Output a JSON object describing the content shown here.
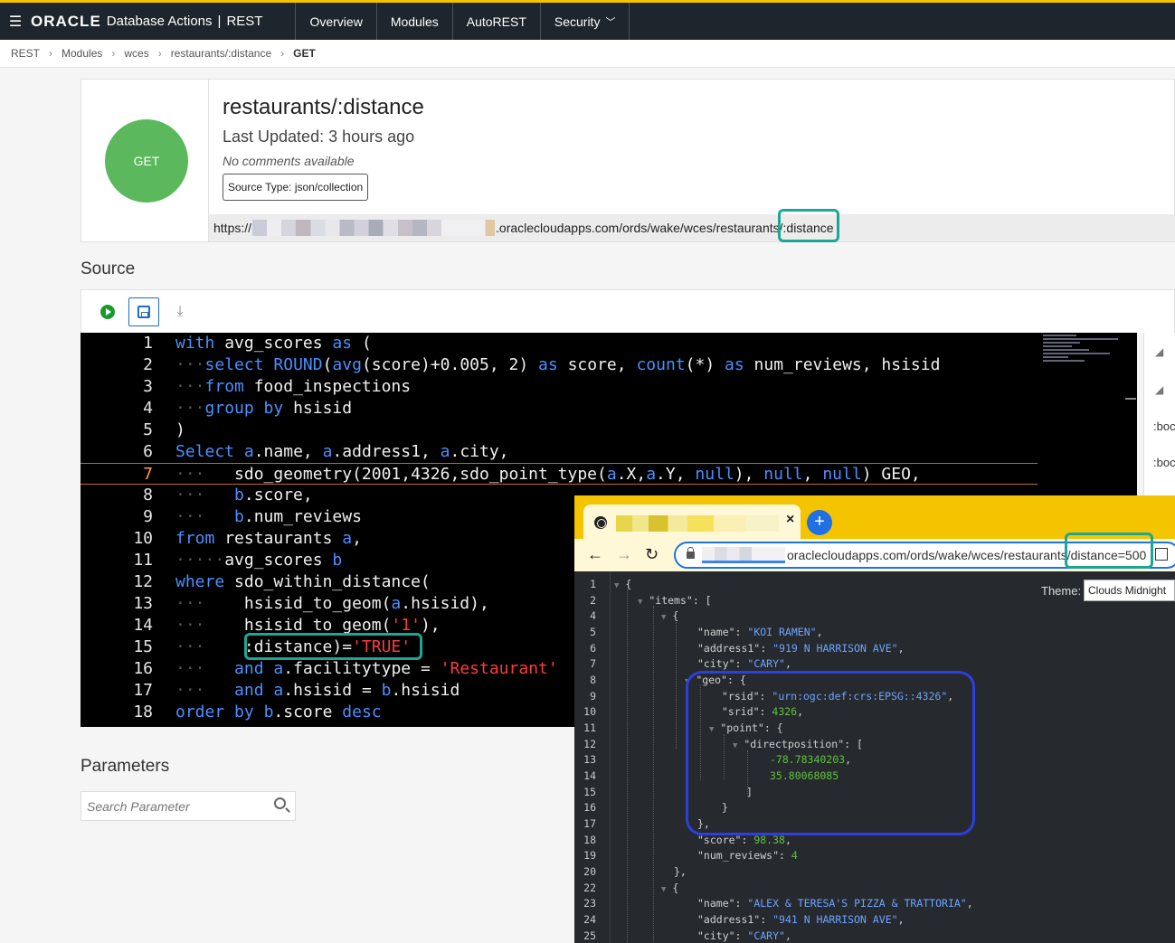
{
  "app": {
    "logo": "ORACLE",
    "product": "Database Actions",
    "separator": "|",
    "section": "REST"
  },
  "nav": {
    "items": [
      "Overview",
      "Modules",
      "AutoREST",
      "Security"
    ]
  },
  "breadcrumb": [
    "REST",
    "Modules",
    "wces",
    "restaurants/:distance",
    "GET"
  ],
  "handler": {
    "method": "GET",
    "title": "restaurants/:distance",
    "last_updated": "Last Updated: 3 hours ago",
    "comments": "No comments available",
    "source_type": "Source Type: json/collection",
    "url_prefix": "https://",
    "url_suffix": ".oraclecloudapps.com/ords/wake/wces/restaurants/",
    "url_param": ":distance"
  },
  "source": {
    "label": "Source",
    "lines": [
      {
        "n": "1"
      },
      {
        "n": "2"
      },
      {
        "n": "3"
      },
      {
        "n": "4"
      },
      {
        "n": "5"
      },
      {
        "n": "6"
      },
      {
        "n": "7"
      },
      {
        "n": "8"
      },
      {
        "n": "9"
      },
      {
        "n": "10"
      },
      {
        "n": "11"
      },
      {
        "n": "12"
      },
      {
        "n": "13"
      },
      {
        "n": "14"
      },
      {
        "n": "15"
      },
      {
        "n": "16"
      },
      {
        "n": "17"
      },
      {
        "n": "18"
      }
    ],
    "code": {
      "l1": [
        "with",
        "avg_scores",
        "as",
        "("
      ],
      "l2": [
        "select",
        "ROUND",
        "(",
        "avg",
        "(",
        "score",
        ")",
        "+0.005,",
        "2",
        ")",
        "as",
        "score,",
        "count",
        "(*)",
        "as",
        "num_reviews,",
        "hsisid"
      ],
      "l3": [
        "from",
        "food_inspections"
      ],
      "l4": [
        "group",
        "by",
        "hsisid"
      ],
      "l5": [
        ")"
      ],
      "l6": [
        "Select",
        "a",
        ".name,",
        "a",
        ".address1,",
        "a",
        ".city,"
      ],
      "l7": [
        "sdo_geometry(2001,4326,sdo_point_type(",
        "a",
        ".X,",
        "a",
        ".Y,",
        "null",
        "),",
        "null",
        ",",
        "null",
        ")",
        "GEO,"
      ],
      "l8": [
        "b",
        ".score,"
      ],
      "l9": [
        "b",
        ".num_reviews"
      ],
      "l10": [
        "from",
        "restaurants",
        "a",
        ","
      ],
      "l11": [
        "avg_scores",
        "b"
      ],
      "l12": [
        "where",
        "sdo_within_distance("
      ],
      "l13": [
        "hsisid_to_geom(",
        "a",
        ".hsisid),"
      ],
      "l14": [
        "hsisid_to_geom(",
        "'1'",
        "),"
      ],
      "l15": [
        ":distance)=",
        "'TRUE'"
      ],
      "l16": [
        "and",
        "a",
        ".facilitytype",
        "=",
        "'Restaurant'"
      ],
      "l17": [
        "and",
        "a",
        ".hsisid",
        "=",
        "b",
        ".hsisid"
      ],
      "l18": [
        "order",
        "by",
        "b",
        ".score",
        "desc"
      ]
    }
  },
  "side_panel": {
    "items": [
      ":boc",
      ":boc"
    ]
  },
  "parameters": {
    "label": "Parameters",
    "search_placeholder": "Search Parameter"
  },
  "browser": {
    "tab_close": "×",
    "new_tab": "+",
    "url_domain": "oraclecloudapps.com/ords/wake/wces/restaurants",
    "url_param": "/distance=500",
    "theme_label": "Theme:",
    "theme_value": "Clouds Midnight",
    "json_line_numbers": [
      "1",
      "2",
      "4",
      "5",
      "6",
      "7",
      "8",
      "9",
      "10",
      "11",
      "12",
      "13",
      "14",
      "15",
      "16",
      "17",
      "18",
      "19",
      "20",
      "22",
      "23",
      "24",
      "25"
    ],
    "json": {
      "items_key": "\"items\": [",
      "open_brace": "{",
      "close_brace_comma": "},",
      "close_brace": "}",
      "close_bracket": "]",
      "name_key": "\"name\": ",
      "name_1": "\"KOI RAMEN\"",
      "address_key": "\"address1\": ",
      "address_1": "\"919 N HARRISON AVE\"",
      "city_key": "\"city\": ",
      "city_1": "\"CARY\"",
      "geo_key": "\"geo\": {",
      "rsid_key": "\"rsid\": ",
      "rsid_val": "\"urn:ogc:def:crs:EPSG::4326\"",
      "srid_key": "\"srid\": ",
      "srid_val": "4326",
      "point_key": "\"point\": {",
      "directposition_key": "\"directposition\": [",
      "coord_1": "-78.78340203",
      "coord_2": "35.80068085",
      "score_key": "\"score\": ",
      "score_val": "98.38",
      "num_reviews_key": "\"num_reviews\": ",
      "num_reviews_val": "4",
      "name_2": "\"ALEX & TERESA'S PIZZA & TRATTORIA\"",
      "address_2": "\"941 N HARRISON AVE\"",
      "city_2": "\"CARY\""
    }
  },
  "colors": {
    "topbar": "#1e252c",
    "accent_yellow": "#f5c400",
    "get_green": "#5cb85c",
    "highlight_teal": "#1ea694",
    "highlight_blue": "#2d3fe0",
    "keyword_blue": "#4b8fff",
    "string_red": "#ff3b3b"
  }
}
